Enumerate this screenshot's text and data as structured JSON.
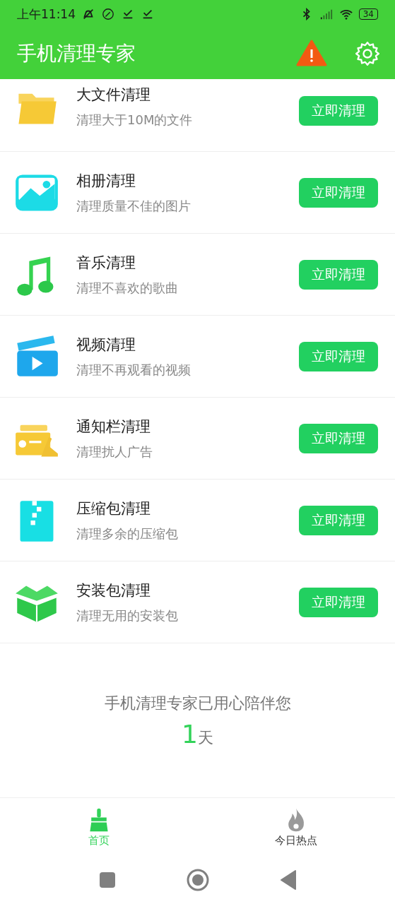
{
  "status_bar": {
    "time": "上午11:14",
    "battery": "34"
  },
  "app_bar": {
    "title": "手机清理专家"
  },
  "items": [
    {
      "kind": "folder",
      "title": "大文件清理",
      "subtitle": "清理大于10M的文件",
      "button": "立即清理"
    },
    {
      "kind": "photo",
      "title": "相册清理",
      "subtitle": "清理质量不佳的图片",
      "button": "立即清理"
    },
    {
      "kind": "music",
      "title": "音乐清理",
      "subtitle": "清理不喜欢的歌曲",
      "button": "立即清理"
    },
    {
      "kind": "video",
      "title": "视频清理",
      "subtitle": "清理不再观看的视频",
      "button": "立即清理"
    },
    {
      "kind": "notification",
      "title": "通知栏清理",
      "subtitle": "清理扰人广告",
      "button": "立即清理"
    },
    {
      "kind": "zip",
      "title": "压缩包清理",
      "subtitle": "清理多余的压缩包",
      "button": "立即清理"
    },
    {
      "kind": "package",
      "title": "安装包清理",
      "subtitle": "清理无用的安装包",
      "button": "立即清理"
    }
  ],
  "companion": {
    "message": "手机清理专家已用心陪伴您",
    "days": "1",
    "unit": "天"
  },
  "bottom_nav": [
    {
      "kind": "broom",
      "label": "首页",
      "selected": true
    },
    {
      "kind": "flame",
      "label": "今日热点",
      "selected": false
    }
  ]
}
